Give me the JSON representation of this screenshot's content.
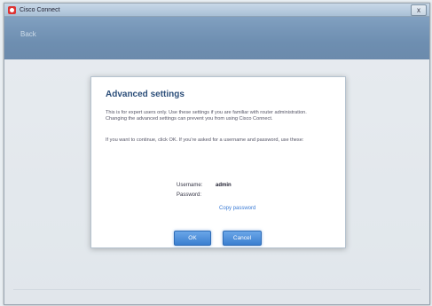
{
  "window": {
    "title": "Cisco Connect",
    "close_glyph": "x"
  },
  "header": {
    "back_label": "Back"
  },
  "dialog": {
    "title": "Advanced settings",
    "description": "This is for expert users only. Use these settings if you are familiar with router administration. Changing the advanced settings can prevent you from using Cisco Connect.",
    "instructions": "If you want to continue, click OK. If you're asked for a username and password, use these:",
    "username_label": "Username:",
    "username_value": "admin",
    "password_label": "Password:",
    "password_value": "",
    "copy_password_label": "Copy password",
    "ok_label": "OK",
    "cancel_label": "Cancel"
  },
  "colors": {
    "accent": "#3b7fd0",
    "header": "#3e6b9b",
    "title_text": "#2d4f7a"
  },
  "icons": {
    "app": "cisco-logo-icon",
    "close": "close-icon"
  }
}
